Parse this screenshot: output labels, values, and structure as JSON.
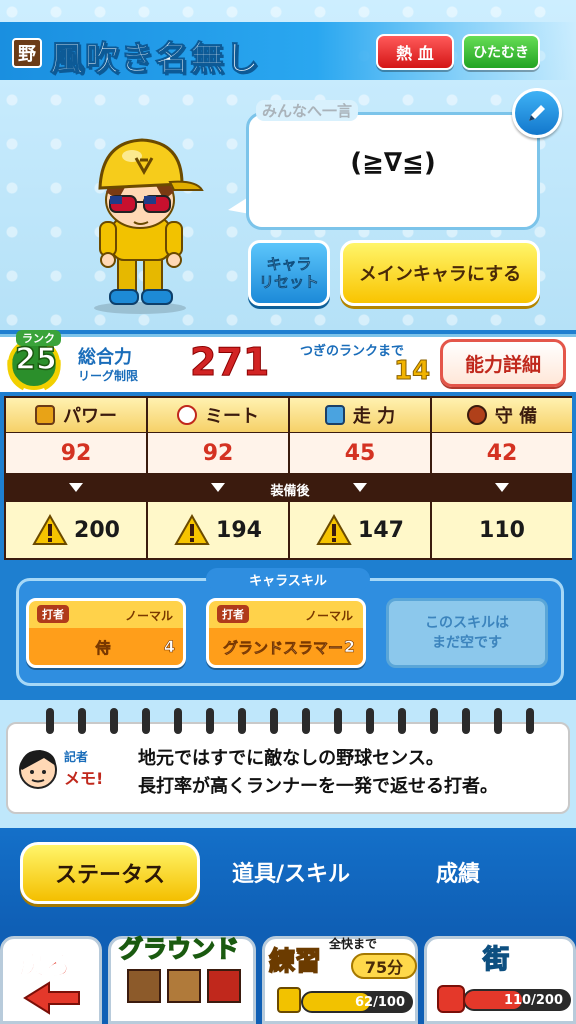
{
  "header": {
    "badge": "野",
    "player_name": "風吹き名無し",
    "traits": [
      "熱 血",
      "ひたむき"
    ]
  },
  "comment": {
    "label": "みんなへ一言",
    "text": "(≧∇≦)"
  },
  "actions": {
    "reset_label": "キャラ\nリセット",
    "main_label": "メインキャラにする"
  },
  "rank": {
    "label": "ランク",
    "value": "25",
    "total_label": "総合力",
    "league_label": "リーグ制限",
    "total_value": "271",
    "next_label": "つぎのランクまで",
    "next_value": "14",
    "detail_button": "能力詳細"
  },
  "stats": {
    "equip_label": "装備後",
    "columns": [
      {
        "label": "パワー",
        "value": "92",
        "after": "200",
        "warn": true,
        "icon": "power-icon"
      },
      {
        "label": "ミート",
        "value": "92",
        "after": "194",
        "warn": true,
        "icon": "meet-icon"
      },
      {
        "label": "走 力",
        "value": "45",
        "after": "147",
        "warn": true,
        "icon": "speed-icon"
      },
      {
        "label": "守 備",
        "value": "42",
        "after": "110",
        "warn": false,
        "icon": "glove-icon"
      }
    ]
  },
  "skills": {
    "title": "キャラスキル",
    "cards": [
      {
        "type": "打者",
        "rarity": "ノーマル",
        "name": "侍",
        "level": "4"
      },
      {
        "type": "打者",
        "rarity": "ノーマル",
        "name": "グランドスラマー",
        "level": "2"
      }
    ],
    "empty_text_1": "このスキルは",
    "empty_text_2": "まだ空です"
  },
  "memo": {
    "tag_top": "記者",
    "tag_bottom": "メモ!",
    "line1": "地元ではすでに敵なしの野球センス。",
    "line2": "長打率が高くランナーを一発で返せる打者。"
  },
  "tabs": {
    "status": "ステータス",
    "items": "道具/スキル",
    "record": "成績"
  },
  "nav": {
    "back": "戻る",
    "ground": "グラウンド",
    "practice": "練習",
    "practice_sub": "全快まで",
    "practice_time": "75分",
    "practice_gauge": "62/100",
    "practice_fill": 0.62,
    "town": "街",
    "town_gauge": "110/200",
    "town_fill": 0.55
  },
  "colors": {
    "accent_blue": "#1e7fd0",
    "stat_red": "#d43222",
    "rank_green": "#3aa33a",
    "total_red": "#d22424"
  }
}
